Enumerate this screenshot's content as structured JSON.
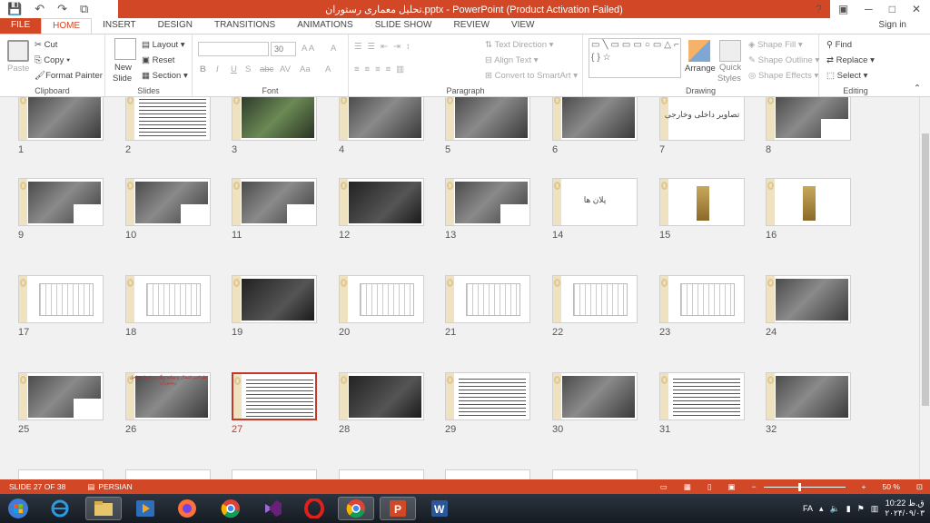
{
  "app": {
    "window_title": "تحلیل معماری رستوران.pptx - PowerPoint (Product Activation Failed)",
    "sign_in": "Sign in",
    "window_controls": [
      "?",
      "▣",
      "─",
      "□",
      "✕"
    ]
  },
  "qat": [
    "save-icon",
    "undo-icon",
    "redo-icon",
    "slideshow-icon"
  ],
  "tabs": [
    "FILE",
    "HOME",
    "INSERT",
    "DESIGN",
    "TRANSITIONS",
    "ANIMATIONS",
    "SLIDE SHOW",
    "REVIEW",
    "VIEW"
  ],
  "ribbon": {
    "clipboard": {
      "label": "Clipboard",
      "paste": "Paste",
      "cut": "Cut",
      "copy": "Copy",
      "format_painter": "Format Painter"
    },
    "slides": {
      "label": "Slides",
      "new_slide_1": "New",
      "new_slide_2": "Slide",
      "layout": "Layout",
      "reset": "Reset",
      "section": "Section"
    },
    "font": {
      "label": "Font",
      "font_name": "",
      "font_size": "30",
      "buttons": [
        "B",
        "I",
        "U",
        "S",
        "abc",
        "AV",
        "Aa",
        "A"
      ]
    },
    "paragraph": {
      "label": "Paragraph",
      "text_direction": "Text Direction",
      "align_text": "Align Text",
      "convert_smartart": "Convert to SmartArt"
    },
    "drawing": {
      "label": "Drawing",
      "arrange": "Arrange",
      "quick_styles_1": "Quick",
      "quick_styles_2": "Styles",
      "shape_fill": "Shape Fill",
      "shape_outline": "Shape Outline",
      "shape_effects": "Shape Effects"
    },
    "editing": {
      "label": "Editing",
      "find": "Find",
      "replace": "Replace",
      "select": "Select"
    }
  },
  "slides": [
    {
      "n": "1"
    },
    {
      "n": "2"
    },
    {
      "n": "3"
    },
    {
      "n": "4"
    },
    {
      "n": "5"
    },
    {
      "n": "6"
    },
    {
      "n": "7",
      "title": "تصاویر داخلی وخارجی"
    },
    {
      "n": "8"
    },
    {
      "n": "9"
    },
    {
      "n": "10"
    },
    {
      "n": "11"
    },
    {
      "n": "12"
    },
    {
      "n": "13"
    },
    {
      "n": "14",
      "title": "پلان ها"
    },
    {
      "n": "15"
    },
    {
      "n": "16"
    },
    {
      "n": "17"
    },
    {
      "n": "18"
    },
    {
      "n": "19"
    },
    {
      "n": "20"
    },
    {
      "n": "21"
    },
    {
      "n": "22"
    },
    {
      "n": "23"
    },
    {
      "n": "24"
    },
    {
      "n": "25"
    },
    {
      "n": "26",
      "title": "طراحی انتقال و سایه رنگ در فضای داخل رستوران"
    },
    {
      "n": "27",
      "selected": true
    },
    {
      "n": "28"
    },
    {
      "n": "29"
    },
    {
      "n": "30"
    },
    {
      "n": "31"
    },
    {
      "n": "32"
    }
  ],
  "status": {
    "slide_info": "SLIDE 27 OF 38",
    "language": "PERSIAN",
    "zoom": "50 %"
  },
  "taskbar": {
    "apps": [
      "start-icon",
      "ie-icon",
      "file-explorer-icon",
      "media-player-icon",
      "firefox-icon",
      "chrome-icon",
      "visual-studio-icon",
      "opera-icon",
      "chrome-icon",
      "powerpoint-icon",
      "word-icon"
    ],
    "lang": "FA",
    "time": "10:22 ق.ظ",
    "date": "۲۰۲۴/۰۹/۰۳"
  }
}
